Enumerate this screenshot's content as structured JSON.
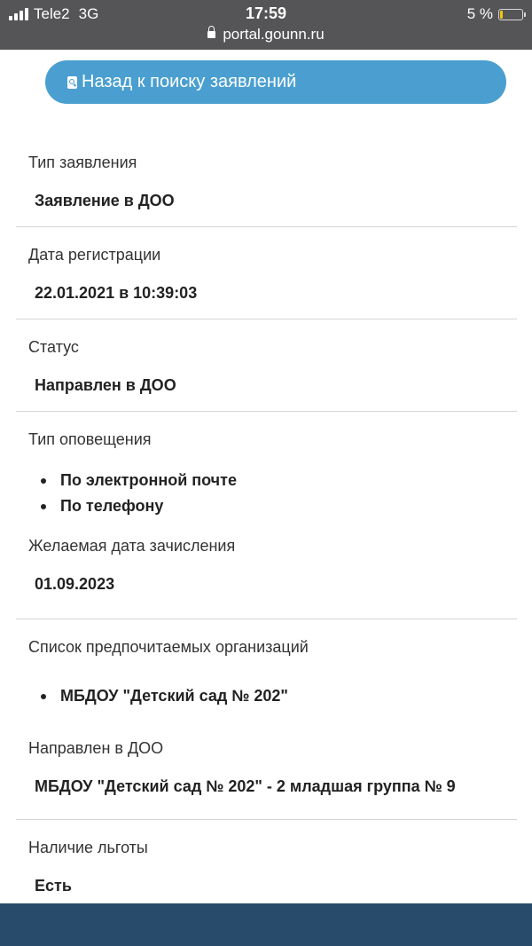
{
  "status_bar": {
    "carrier": "Tele2",
    "network": "3G",
    "time": "17:59",
    "url": "portal.gounn.ru",
    "battery": "5 %"
  },
  "back_button": {
    "label": "Назад к поиску заявлений",
    "color": "#4a9fd0"
  },
  "fields": {
    "type": {
      "label": "Тип заявления",
      "value": "Заявление в ДОО"
    },
    "reg_date": {
      "label": "Дата регистрации",
      "value": "22.01.2021 в 10:39:03"
    },
    "status": {
      "label": "Статус",
      "value": "Направлен в ДОО"
    },
    "notify": {
      "label": "Тип оповещения",
      "items": [
        "По электронной почте",
        "По телефону"
      ]
    },
    "desired_date": {
      "label": "Желаемая дата зачисления",
      "value": "01.09.2023"
    },
    "orgs": {
      "label": "Список предпочитаемых организаций",
      "items": [
        "МБДОУ \"Детский сад № 202\""
      ]
    },
    "directed": {
      "label": "Направлен в ДОО",
      "value": "МБДОУ \"Детский сад № 202\" - 2 младшая группа № 9"
    },
    "benefit": {
      "label": "Наличие льготы",
      "value": "Есть"
    }
  },
  "colors": {
    "status_bar": "#555557",
    "footer": "#294b6b",
    "divider": "#d4d4d4"
  }
}
